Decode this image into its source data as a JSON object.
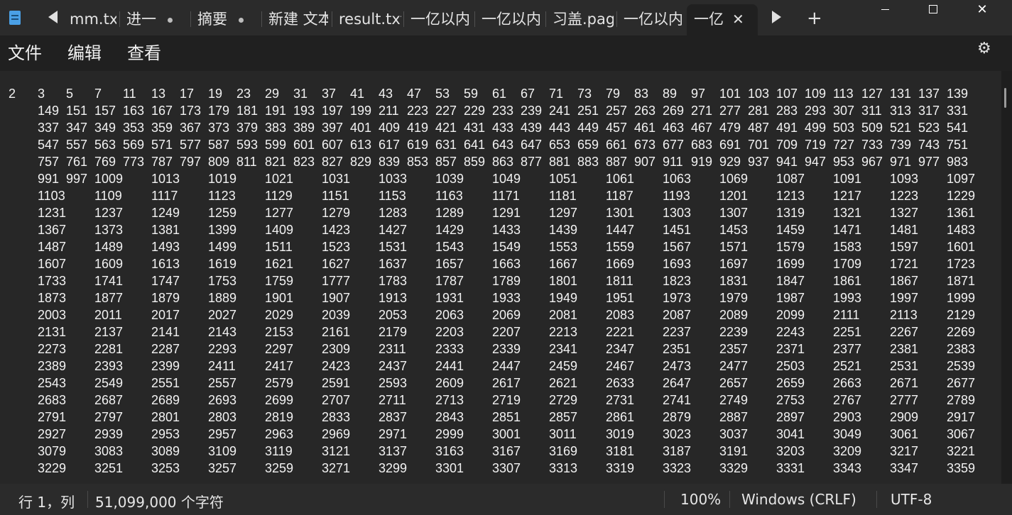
{
  "window": {
    "tabs": [
      {
        "label": "mm.tx"
      },
      {
        "label": "进一"
      },
      {
        "label": "摘要"
      },
      {
        "label": "新建 文本"
      },
      {
        "label": "result.txt"
      },
      {
        "label": "一亿以内"
      },
      {
        "label": "一亿以内"
      },
      {
        "label": "习盖.pag"
      },
      {
        "label": "一亿以内"
      },
      {
        "label": "一亿"
      }
    ],
    "new_tab": "+",
    "controls": {
      "close": "✕"
    }
  },
  "menu": {
    "file": "文件",
    "edit": "编辑",
    "view": "查看",
    "settings_icon": "gear-icon"
  },
  "editor": {
    "first_value": "2",
    "rows": [
      "3 5 7 11 13 17 19 23 29 31 37 41 43 47 53 59 61 67 71 73 79 83 89 97 101 103 107 109 113 127 131 137 139",
      "149 151 157 163 167 173 179 181 191 193 197 199 211 223 227 229 233 239 241 251 257 263 269 271 277 281 283 293 307 311 313 317 331",
      "337 347 349 353 359 367 373 379 383 389 397 401 409 419 421 431 433 439 443 449 457 461 463 467 479 487 491 499 503 509 521 523 541",
      "547 557 563 569 571 577 587 593 599 601 607 613 617 619 631 641 643 647 653 659 661 673 677 683 691 701 709 719 727 733 739 743 751",
      "757 761 769 773 787 797 809 811 821 823 827 829 839 853 857 859 863 877 881 883 887 907 911 919 929 937 941 947 953 967 971 977 983",
      "991 997 1009 1013 1019 1021 1031 1033 1039 1049 1051 1061 1063 1069 1087 1091 1093 1097",
      "1103 1109 1117 1123 1129 1151 1153 1163 1171 1181 1187 1193 1201 1213 1217 1223 1229",
      "1231 1237 1249 1259 1277 1279 1283 1289 1291 1297 1301 1303 1307 1319 1321 1327 1361",
      "1367 1373 1381 1399 1409 1423 1427 1429 1433 1439 1447 1451 1453 1459 1471 1481 1483",
      "1487 1489 1493 1499 1511 1523 1531 1543 1549 1553 1559 1567 1571 1579 1583 1597 1601",
      "1607 1609 1613 1619 1621 1627 1637 1657 1663 1667 1669 1693 1697 1699 1709 1721 1723",
      "1733 1741 1747 1753 1759 1777 1783 1787 1789 1801 1811 1823 1831 1847 1861 1867 1871",
      "1873 1877 1879 1889 1901 1907 1913 1931 1933 1949 1951 1973 1979 1987 1993 1997 1999",
      "2003 2011 2017 2027 2029 2039 2053 2063 2069 2081 2083 2087 2089 2099 2111 2113 2129",
      "2131 2137 2141 2143 2153 2161 2179 2203 2207 2213 2221 2237 2239 2243 2251 2267 2269",
      "2273 2281 2287 2293 2297 2309 2311 2333 2339 2341 2347 2351 2357 2371 2377 2381 2383",
      "2389 2393 2399 2411 2417 2423 2437 2441 2447 2459 2467 2473 2477 2503 2521 2531 2539",
      "2543 2549 2551 2557 2579 2591 2593 2609 2617 2621 2633 2647 2657 2659 2663 2671 2677",
      "2683 2687 2689 2693 2699 2707 2711 2713 2719 2729 2731 2741 2749 2753 2767 2777 2789",
      "2791 2797 2801 2803 2819 2833 2837 2843 2851 2857 2861 2879 2887 2897 2903 2909 2917",
      "2927 2939 2953 2957 2963 2969 2971 2999 3001 3011 3019 3023 3037 3041 3049 3061 3067",
      "3079 3083 3089 3109 3119 3121 3137 3163 3167 3169 3181 3187 3191 3203 3209 3217 3221",
      "3229 3251 3253 3257 3259 3271 3299 3301 3307 3313 3319 3323 3329 3331 3343 3347 3359"
    ]
  },
  "status": {
    "position": "行 1，列",
    "char_count": "51,099,000 个字符",
    "zoom": "100%",
    "line_ending": "Windows (CRLF)",
    "encoding": "UTF-8"
  }
}
